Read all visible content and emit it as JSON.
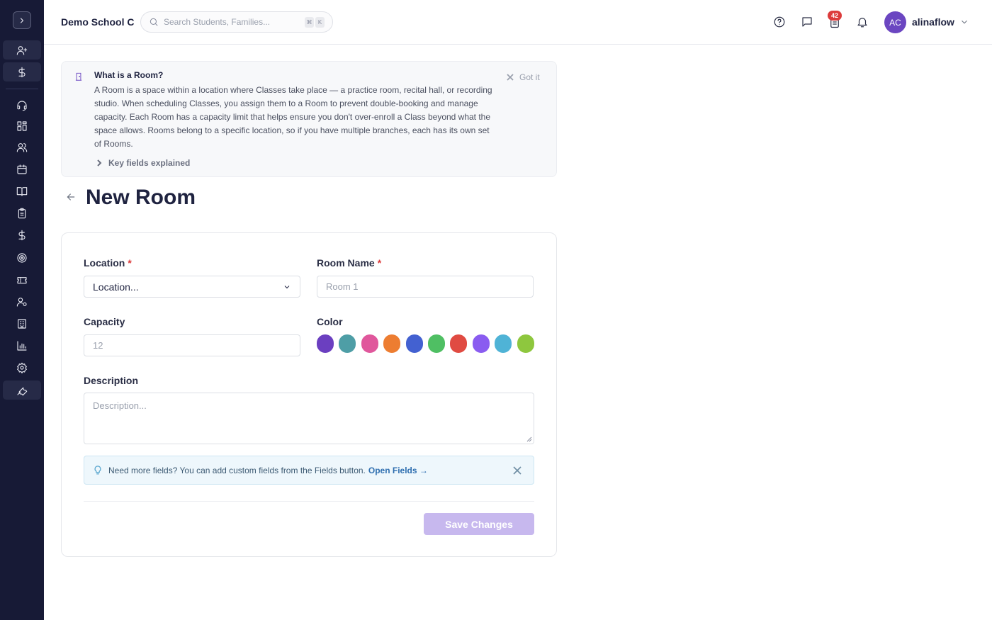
{
  "header": {
    "school_name": "Demo School C",
    "search_placeholder": "Search Students, Families...",
    "shortcut_keys": [
      "⌘",
      "K"
    ],
    "notification_count": "42",
    "user_initials": "AC",
    "username": "alinaflow"
  },
  "info": {
    "title": "What is a Room?",
    "body": "A Room is a space within a location where Classes take place — a practice room, recital hall, or recording studio. When scheduling Classes, you assign them to a Room to prevent double-booking and manage capacity. Each Room has a capacity limit that helps ensure you don't over-enroll a Class beyond what the space allows. Rooms belong to a specific location, so if you have multiple branches, each has its own set of Rooms.",
    "got_it": "Got it",
    "key_fields": "Key fields explained"
  },
  "page": {
    "title": "New Room"
  },
  "form": {
    "location_label": "Location",
    "location_value": "Location...",
    "room_name_label": "Room Name",
    "room_name_placeholder": "Room 1",
    "capacity_label": "Capacity",
    "capacity_placeholder": "12",
    "color_label": "Color",
    "colors": [
      "#6b3fc0",
      "#4e9ea6",
      "#e0579c",
      "#ed7d31",
      "#4361d1",
      "#4fbf63",
      "#e04b42",
      "#8a5cf0",
      "#4fb3d6",
      "#8ec73e"
    ],
    "description_label": "Description",
    "description_placeholder": "Description...",
    "required_mark": "*",
    "tip_text": "Need more fields? You can add custom fields from the Fields button.",
    "tip_link": "Open Fields →",
    "save_label": "Save Changes"
  }
}
